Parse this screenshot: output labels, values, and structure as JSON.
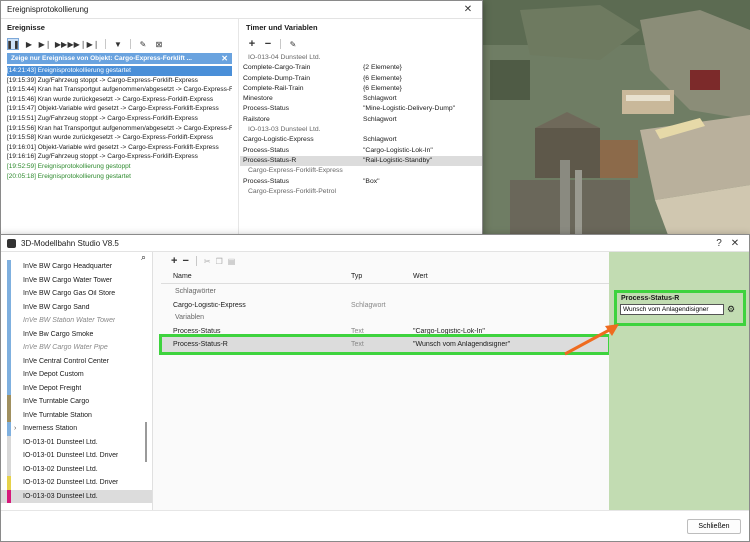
{
  "scene": {
    "sky_color": "#8a9a7e"
  },
  "log_window": {
    "title": "Ereignisprotokollierung",
    "events_header": "Ereignisse",
    "filter_text": "Zeige nur Ereignisse von Objekt: Cargo-Express-Forklift ...",
    "log_lines": [
      "[14:21:43] Ereignisprotokollierung gestartet",
      "[19:15:39] Zug/Fahrzeug stoppt -> Cargo-Express-Forklift-Express",
      "[19:15:44] Kran hat Transportgut aufgenommen/abgesetzt -> Cargo-Express-Forklift-Express",
      "[19:15:46] Kran wurde zurückgesetzt -> Cargo-Express-Forklift-Express",
      "[19:15:47]     Objekt-Variable wird gesetzt -> Cargo-Express-Forklift-Express",
      "[19:15:51] Zug/Fahrzeug stoppt -> Cargo-Express-Forklift-Express",
      "[19:15:56] Kran hat Transportgut aufgenommen/abgesetzt -> Cargo-Express-Forklift-Express",
      "[19:15:58] Kran wurde zurückgesetzt -> Cargo-Express-Forklift-Express",
      "[19:16:01]     Objekt-Variable wird gesetzt -> Cargo-Express-Forklift-Express",
      "[19:16:16] Zug/Fahrzeug stoppt -> Cargo-Express-Forklift-Express",
      "[19:52:59] Ereignisprotokollierung gestoppt",
      "[20:05:18] Ereignisprotokollierung gestartet"
    ],
    "tv_header": "Timer und Variablen",
    "tv_rows": [
      {
        "k": "IO-013-04 Dunsteel Ltd.",
        "v": "",
        "type": "grp"
      },
      {
        "k": "Complete-Cargo-Train",
        "v": "{2 Elemente}",
        "type": "row"
      },
      {
        "k": "Complete-Dump-Train",
        "v": "{6 Elemente}",
        "type": "row"
      },
      {
        "k": "Complete-Rail-Train",
        "v": "{6 Elemente}",
        "type": "row"
      },
      {
        "k": "Minestore",
        "v": "Schlagwort",
        "type": "row"
      },
      {
        "k": "Process-Status",
        "v": "\"Mine-Logistic-Delivery-Dump\"",
        "type": "row"
      },
      {
        "k": "Railstore",
        "v": "Schlagwort",
        "type": "row"
      },
      {
        "k": "IO-013-03 Dunsteel Ltd.",
        "v": "",
        "type": "grp"
      },
      {
        "k": "Cargo-Logistic-Express",
        "v": "Schlagwort",
        "type": "row"
      },
      {
        "k": "Process-Status",
        "v": "\"Cargo-Logistic-Lok-In\"",
        "type": "row"
      },
      {
        "k": "Process-Status-R",
        "v": "\"Rail-Logistic-Standby\"",
        "type": "sel"
      },
      {
        "k": "Cargo-Express-Forklift-Express",
        "v": "",
        "type": "grp"
      },
      {
        "k": "Process-Status",
        "v": "\"Box\"",
        "type": "row"
      },
      {
        "k": "Cargo-Express-Forklift-Petrol",
        "v": "",
        "type": "grp"
      }
    ]
  },
  "main_window": {
    "title": "3D-Modellbahn Studio V8.5",
    "left_list": [
      {
        "label": "InVe  BW  Cargo  Headquarter",
        "color": "#7fb0df",
        "style": ""
      },
      {
        "label": "InVe  BW  Cargo  Water Tower",
        "color": "#7fb0df",
        "style": ""
      },
      {
        "label": "InVe  BW  Cargo Gas Oil Store",
        "color": "#7fb0df",
        "style": ""
      },
      {
        "label": "InVe  BW  Cargo Sand",
        "color": "#7fb0df",
        "style": ""
      },
      {
        "label": "InVe  BW  Station  Water Tower",
        "color": "#7fb0df",
        "style": "it"
      },
      {
        "label": "InVe  Bw Cargo Smoke",
        "color": "#7fb0df",
        "style": ""
      },
      {
        "label": "InVe  BW Cargo Water Pipe",
        "color": "#7fb0df",
        "style": "it"
      },
      {
        "label": "InVe  Central Control Center",
        "color": "#7fb0df",
        "style": ""
      },
      {
        "label": "InVe  Depot Custom",
        "color": "#7fb0df",
        "style": ""
      },
      {
        "label": "InVe  Depot Freight",
        "color": "#7fb0df",
        "style": ""
      },
      {
        "label": "InVe  Turntable  Cargo",
        "color": "#a09060",
        "style": ""
      },
      {
        "label": "InVe  Turntable  Station",
        "color": "#a09060",
        "style": ""
      },
      {
        "label": "Inverness Station",
        "color": "#7fb0df",
        "style": "exp"
      },
      {
        "label": "IO-013-01 Dunsteel Ltd.",
        "color": "#d8d8d8",
        "style": ""
      },
      {
        "label": "IO-013-01 Dunsteel Ltd. Driver",
        "color": "#d8d8d8",
        "style": ""
      },
      {
        "label": "IO-013-02 Dunsteel Ltd.",
        "color": "#d8d8d8",
        "style": ""
      },
      {
        "label": "IO-013-02 Dunsteel Ltd. Driver",
        "color": "#e6d24a",
        "style": ""
      },
      {
        "label": "IO-013-03 Dunsteel Ltd.",
        "color": "#d6197a",
        "style": "sel"
      }
    ],
    "columns": {
      "name": "Name",
      "type": "Typ",
      "value": "Wert"
    },
    "group_keywords": "Schlagwörter",
    "group_vars": "Variablen",
    "rows": [
      {
        "name": "Cargo-Logistic-Express",
        "type": "Schlagwort",
        "value": ""
      },
      {
        "name": "Process-Status",
        "type": "Text",
        "value": "\"Cargo-Logistic-Lok-In\""
      },
      {
        "name": "Process-Status-R",
        "type": "Text",
        "value": "\"Wunsch vom Anlagendisigner\""
      }
    ],
    "editor": {
      "label": "Process-Status-R",
      "value": "Wunsch vom Anlagendisigner"
    },
    "close_button": "Schließen"
  },
  "colors": {
    "highlight_green": "#3ed33e",
    "arrow_orange": "#ef6b1f",
    "panel_green": "#c2dcb2",
    "filter_blue": "#6aa3df"
  }
}
